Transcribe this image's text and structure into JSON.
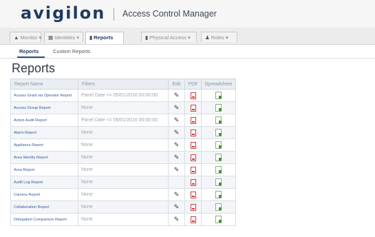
{
  "header": {
    "logo": "avigilon",
    "app_title": "Access Control Manager"
  },
  "nav": {
    "tabs": [
      {
        "label": "Monitor",
        "icon": "monitor-icon",
        "dropdown": true
      },
      {
        "label": "Identities",
        "icon": "identities-icon",
        "dropdown": true
      },
      {
        "label": "Reports",
        "icon": "bar-chart-icon",
        "dropdown": false,
        "active": true
      },
      {
        "label": "Physical Access",
        "icon": "door-icon",
        "dropdown": true
      },
      {
        "label": "Roles",
        "icon": "users-icon",
        "dropdown": true
      }
    ]
  },
  "subtabs": [
    {
      "label": "Reports",
      "active": true
    },
    {
      "label": "Custom Reports",
      "active": false
    }
  ],
  "page_title": "Reports",
  "table": {
    "headers": {
      "name": "Report Name",
      "filters": "Filters",
      "edit": "Edit",
      "pdf": "PDF",
      "spreadsheet": "Spreadsheet"
    },
    "rows": [
      {
        "name": "Access Grant via Operator Report",
        "filter": "Panel Date <= 05/01/2016 00:00:00",
        "edit": true
      },
      {
        "name": "Access Group Report",
        "filter": "None",
        "edit": true
      },
      {
        "name": "Action Audit Report",
        "filter": "Panel Date <= 05/01/2016 00:00:00",
        "edit": true
      },
      {
        "name": "Alarm Report",
        "filter": "None",
        "edit": true
      },
      {
        "name": "Appliance Report",
        "filter": "None",
        "edit": true
      },
      {
        "name": "Area Identity Report",
        "filter": "None",
        "edit": true
      },
      {
        "name": "Area Report",
        "filter": "None",
        "edit": true
      },
      {
        "name": "Audit Log Report",
        "filter": "None",
        "edit": false
      },
      {
        "name": "Camera Report",
        "filter": "None",
        "edit": true
      },
      {
        "name": "Collaboration Report",
        "filter": "None",
        "edit": true
      },
      {
        "name": "Delegation Comparison Report",
        "filter": "None",
        "edit": true
      }
    ]
  },
  "icons": {
    "edit": "pencil-icon",
    "pdf": "pdf-icon",
    "spreadsheet": "spreadsheet-icon",
    "dropdown": "▾"
  },
  "colors": {
    "brand": "#1f3a5e",
    "link": "#2f5d9a",
    "pdf": "#cc3b3b",
    "spreadsheet": "#3f8f37"
  }
}
